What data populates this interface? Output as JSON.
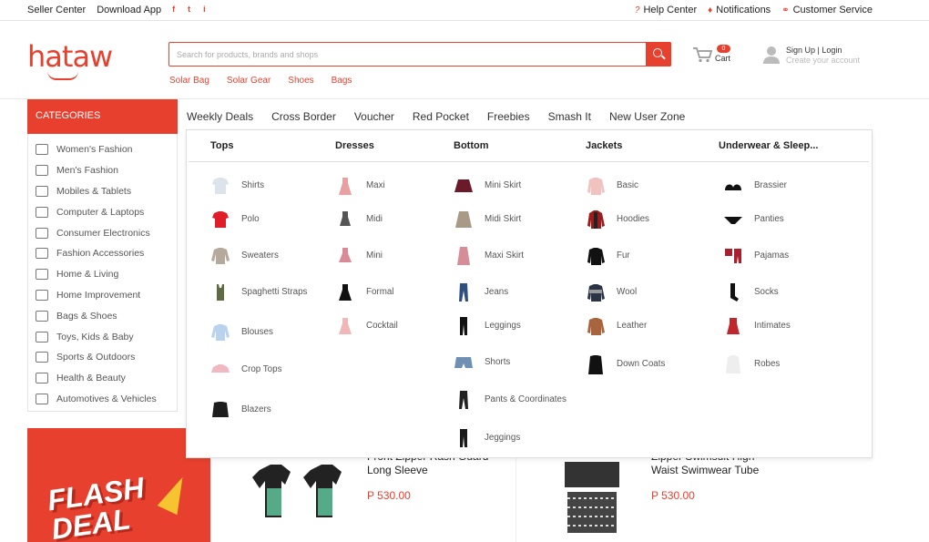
{
  "topbar": {
    "seller_center": "Seller Center",
    "download_app": "Download App",
    "social": [
      "f",
      "t",
      "i"
    ],
    "help_center": "Help Center",
    "notifications": "Notifications",
    "customer_service": "Customer Service"
  },
  "header": {
    "logo": "hataw",
    "search_placeholder": "Search for products, brands and shops",
    "quick_links": [
      "Solar Bag",
      "Solar Gear",
      "Shoes",
      "Bags"
    ],
    "cart_count": "0",
    "cart_label": "Cart",
    "signin_label": "Sign Up | Login",
    "signin_sub": "Create your account"
  },
  "categories": {
    "title": "CATEGORIES",
    "items": [
      "Women's Fashion",
      "Men's Fashion",
      "Mobiles & Tablets",
      "Computer & Laptops",
      "Consumer Electronics",
      "Fashion Accessories",
      "Home & Living",
      "Home Improvement",
      "Bags & Shoes",
      "Toys, Kids & Baby",
      "Sports & Outdoors",
      "Health & Beauty",
      "Automotives & Vehicles"
    ]
  },
  "tabs": [
    "Weekly Deals",
    "Cross Border",
    "Voucher",
    "Red Pocket",
    "Freebies",
    "Smash It",
    "New User Zone"
  ],
  "mega_menu": {
    "columns": [
      {
        "title": "Tops",
        "items": [
          "Shirts",
          "Polo",
          "Sweaters",
          "Spaghetti Straps",
          "Blouses",
          "Crop Tops",
          "Blazers"
        ]
      },
      {
        "title": "Dresses",
        "items": [
          "Maxi",
          "Midi",
          "Mini",
          "Formal",
          "Cocktail"
        ]
      },
      {
        "title": "Bottom",
        "items": [
          "Mini Skirt",
          "Midi Skirt",
          "Maxi Skirt",
          "Jeans",
          "Leggings",
          "Shorts",
          "Pants & Coordinates",
          "Jeggings"
        ]
      },
      {
        "title": "Jackets",
        "items": [
          "Basic",
          "Hoodies",
          "Fur",
          "Wool",
          "Leather",
          "Down Coats"
        ]
      },
      {
        "title": "Underwear & Sleep...",
        "items": [
          "Brassier",
          "Panties",
          "Pajamas",
          "Socks",
          "Intimates",
          "Robes"
        ]
      }
    ]
  },
  "promo": {
    "text_line1": "FLASH",
    "text_line2": "DEAL"
  },
  "products": [
    {
      "title_line1": "Front Zipper Rash Guard",
      "title_line2": "Long Sleeve",
      "price": "P 530.00"
    },
    {
      "title_line1": "Zipper Swimsuit High",
      "title_line2": "Waist Swimwear Tube",
      "price": "P 530.00"
    }
  ],
  "colors": {
    "accent": "#e8402e",
    "text": "#333333",
    "muted": "#555555"
  }
}
